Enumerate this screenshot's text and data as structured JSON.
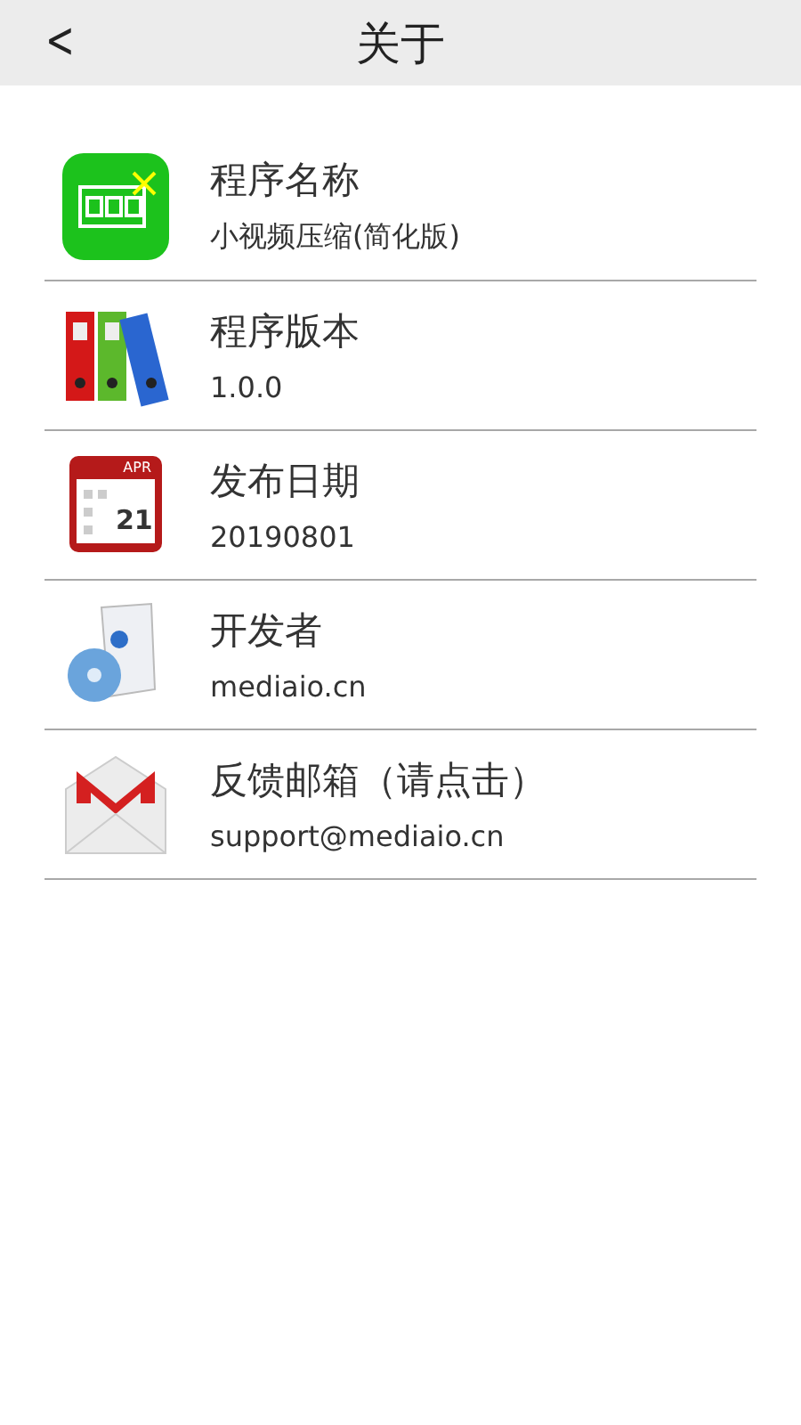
{
  "header": {
    "back": "<",
    "title": "关于"
  },
  "items": [
    {
      "kind": "app",
      "title": "程序名称",
      "value": "小视频压缩(简化版)"
    },
    {
      "kind": "binders",
      "title": "程序版本",
      "value": "1.0.0"
    },
    {
      "kind": "calendar",
      "title": "发布日期",
      "value": "20190801",
      "calendar_month": "APR",
      "calendar_day": "21"
    },
    {
      "kind": "software",
      "title": "开发者",
      "value": "mediaio.cn"
    },
    {
      "kind": "mail",
      "title": "反馈邮箱（请点击）",
      "value": "support@mediaio.cn"
    }
  ]
}
